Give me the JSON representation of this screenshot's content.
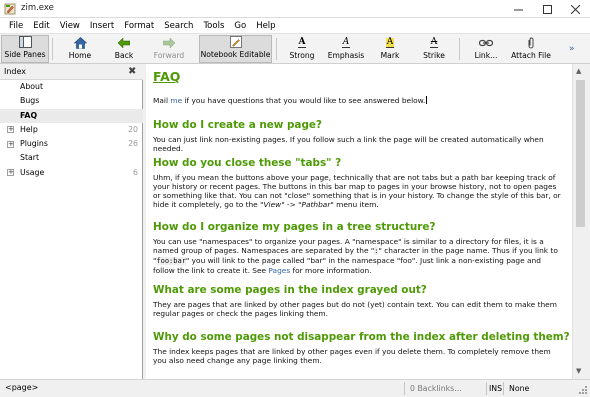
{
  "window": {
    "title": "zim.exe",
    "app_icon": "zim-pencil-icon",
    "controls": {
      "minimize": "minimize-icon",
      "maximize": "maximize-icon",
      "close": "close-icon"
    }
  },
  "menu": [
    "File",
    "Edit",
    "View",
    "Insert",
    "Format",
    "Search",
    "Tools",
    "Go",
    "Help"
  ],
  "toolbar": {
    "side_panes": "Side Panes",
    "home": "Home",
    "back": "Back",
    "forward": "Forward",
    "notebook_editable": "Notebook Editable",
    "strong": "Strong",
    "emphasis": "Emphasis",
    "mark": "Mark",
    "strike": "Strike",
    "link": "Link...",
    "attach_file": "Attach File",
    "more": "»"
  },
  "sidepane": {
    "title": "Index",
    "items": [
      {
        "label": "About",
        "count": "",
        "expandable": false,
        "selected": false
      },
      {
        "label": "Bugs",
        "count": "",
        "expandable": false,
        "selected": false
      },
      {
        "label": "FAQ",
        "count": "",
        "expandable": false,
        "selected": true
      },
      {
        "label": "Help",
        "count": "20",
        "expandable": true,
        "selected": false
      },
      {
        "label": "Plugins",
        "count": "26",
        "expandable": true,
        "selected": false
      },
      {
        "label": "Start",
        "count": "",
        "expandable": false,
        "selected": false
      },
      {
        "label": "Usage",
        "count": "6",
        "expandable": true,
        "selected": false
      }
    ]
  },
  "page": {
    "title": "FAQ",
    "intro": {
      "before": "Mail ",
      "link": "me",
      "after": " if you have questions that you would like to see answered below."
    },
    "sections": [
      {
        "heading": "How do I create a new page?",
        "body": "You can just link non-existing pages. If you follow such a link the page will be created automatically when needed."
      },
      {
        "heading": "How do you close these \"tabs\" ?",
        "body_1": "Uhm, if you mean the buttons above your page, technically that are not tabs but a path bar keeping track of your history or recent pages. The buttons in this bar map to pages in your browse history, not to open pages or something like that. You can not \"close\" something that is in your history. To change the style of this bar, or hide it completely, go to the \"",
        "body_italic": "View",
        "body_2": "\" -> \"",
        "body_italic_2": "Pathbar",
        "body_3": "\" menu item."
      },
      {
        "heading": "How do I organize my pages in a tree structure?",
        "body_1": "You can use \"namespaces\" to organize your pages. A \"namespace\" is similar to a directory for files, it is a named group of pages. Namespaces are separated by the \"",
        "code_1": ":",
        "body_2": "\" character in the page name. Thus if you link to \"",
        "code_2": "foo:bar",
        "body_3": "\" you will link to the page called \"bar\" in the namespace \"foo\". Just link a non-existing page and follow the link to create it. See ",
        "link": "Pages",
        "body_4": " for more information."
      },
      {
        "heading": "What are some pages in the index grayed out?",
        "body": "They are pages that are linked by other pages but do not (yet) contain text. You can edit them to make them regular pages or check the pages linking them."
      },
      {
        "heading": "Why do some pages not disappear from the index after deleting them?",
        "body": "The index keeps pages that are linked by other pages even if you delete them. To completely remove them you also need change any page linking them."
      }
    ]
  },
  "status": {
    "page": "<page>",
    "backlinks": "0 Backlinks...",
    "mode": "INS",
    "style": "None"
  },
  "colors": {
    "heading": "#4e9a06",
    "link": "#3465a4",
    "mark_highlight": "#f4e04a"
  }
}
